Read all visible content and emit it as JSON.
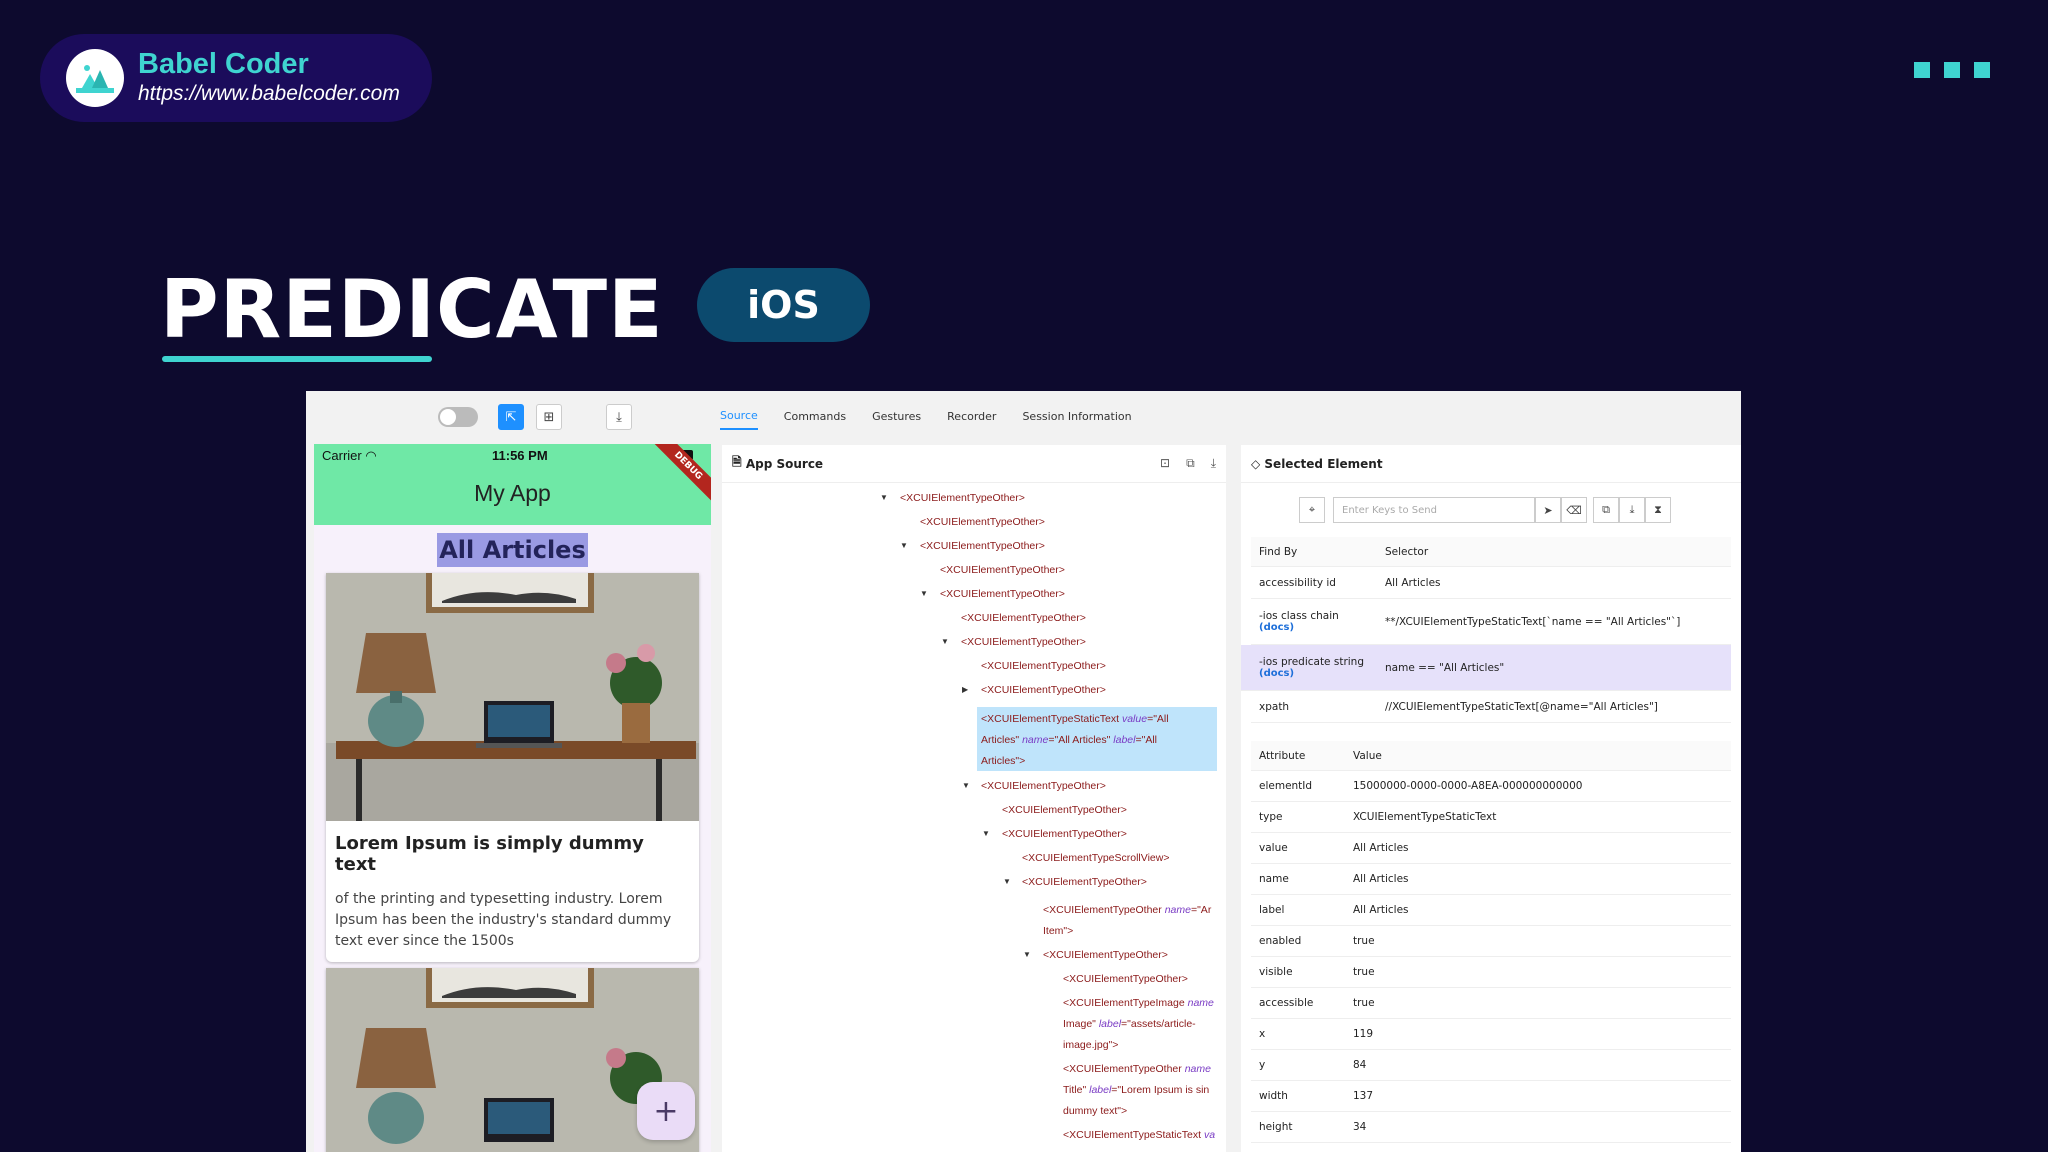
{
  "brand": {
    "title": "Babel Coder",
    "url": "https://www.babelcoder.com"
  },
  "headline": "PREDICATE",
  "platform_badge": "iOS",
  "tabs": [
    "Source",
    "Commands",
    "Gestures",
    "Recorder",
    "Session Information"
  ],
  "active_tab": "Source",
  "phone": {
    "carrier": "Carrier",
    "time": "11:56 PM",
    "app_title": "My App",
    "debug_label": "DEBUG",
    "heading": "All Articles",
    "card_title": "Lorem Ipsum is simply dummy text",
    "card_desc": "of the printing and typesetting industry. Lorem Ipsum has been the industry's standard dummy text ever since the 1500s",
    "fab_label": "+"
  },
  "source_panel": {
    "title": "App Source",
    "nodes": [
      "<XCUIElementTypeOther>",
      "<XCUIElementTypeOther>",
      "<XCUIElementTypeOther>",
      "<XCUIElementTypeOther>",
      "<XCUIElementTypeOther>",
      "<XCUIElementTypeOther>",
      "<XCUIElementTypeOther>",
      "<XCUIElementTypeOther>",
      "<XCUIElementTypeOther>",
      "<XCUIElementTypeStaticText",
      "<XCUIElementTypeOther>",
      "<XCUIElementTypeOther>",
      "<XCUIElementTypeOther>",
      "<XCUIElementTypeScrollView>",
      "<XCUIElementTypeOther>",
      "<XCUIElementTypeOther",
      "<XCUIElementTypeOther>",
      "<XCUIElementTypeOther>",
      "<XCUIElementTypeImage",
      "<XCUIElementTypeOther",
      "<XCUIElementTypeStaticText"
    ],
    "static_text": {
      "attr_value": "value",
      "val_value": "\"All",
      "line2_a": "Articles\"",
      "attr_name": "name",
      "val_name": "=\"All Articles\"",
      "attr_label": "label",
      "val_label": "=\"All",
      "line3": "Articles\">"
    },
    "other_named": {
      "attr": "name",
      "val": "=\"Ar",
      "line2": "Item\">"
    },
    "image_node": {
      "attr": "name",
      "line2a": "Image\"",
      "attr2": "label",
      "val2": "=\"assets/article-",
      "line3": "image.jpg\">"
    },
    "title_node": {
      "attr": "name",
      "line2a": "Title\"",
      "attr2": "label",
      "val2": "=\"Lorem Ipsum is sin",
      "line3": "dummy text\">"
    },
    "last_node_attr": "va"
  },
  "selected_panel": {
    "title": "Selected Element",
    "keys_placeholder": "Enter Keys to Send",
    "find_header": {
      "c1": "Find By",
      "c2": "Selector"
    },
    "find_rows": [
      {
        "by": "accessibility id",
        "docs": "",
        "selector": "All Articles"
      },
      {
        "by": "-ios class chain",
        "docs": "(docs)",
        "selector": "**/XCUIElementTypeStaticText[`name == \"All Articles\"`]"
      },
      {
        "by": "-ios predicate string",
        "docs": "(docs)",
        "selector": "name == \"All Articles\""
      },
      {
        "by": "xpath",
        "docs": "",
        "selector": "//XCUIElementTypeStaticText[@name=\"All Articles\"]"
      }
    ],
    "attr_header": {
      "c1": "Attribute",
      "c2": "Value"
    },
    "attr_rows": [
      {
        "k": "elementId",
        "v": "15000000-0000-0000-A8EA-000000000000"
      },
      {
        "k": "type",
        "v": "XCUIElementTypeStaticText"
      },
      {
        "k": "value",
        "v": "All Articles"
      },
      {
        "k": "name",
        "v": "All Articles"
      },
      {
        "k": "label",
        "v": "All Articles"
      },
      {
        "k": "enabled",
        "v": "true"
      },
      {
        "k": "visible",
        "v": "true"
      },
      {
        "k": "accessible",
        "v": "true"
      },
      {
        "k": "x",
        "v": "119"
      },
      {
        "k": "y",
        "v": "84"
      },
      {
        "k": "width",
        "v": "137"
      },
      {
        "k": "height",
        "v": "34"
      }
    ]
  },
  "colors": {
    "background": "#0d0a2e",
    "accent": "#3fd4d0",
    "brand_pill": "#1b0c5b",
    "ios_pill": "#0c4a6e",
    "app_bar": "#6fe8a6",
    "highlight": "#bfe4fb",
    "selected_row": "#e6e1fa"
  }
}
